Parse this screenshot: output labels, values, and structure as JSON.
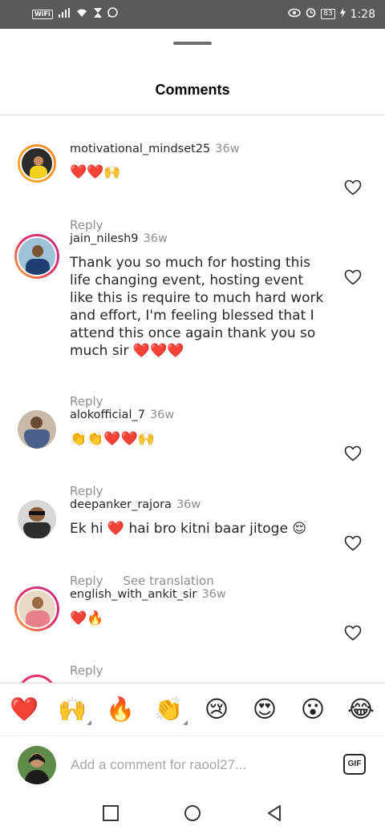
{
  "status_bar": {
    "left_icons": [
      "wifi-tag-icon",
      "signal-icon",
      "wifi-icon",
      "hourglass-icon",
      "whatsapp-icon"
    ],
    "wifi_tag": "WiFi",
    "battery": "83",
    "time": "1:28"
  },
  "sheet": {
    "title": "Comments"
  },
  "comments": [
    {
      "username": "motivational_mindset25",
      "time": "36w",
      "text": "❤️❤️🙌",
      "actions": [
        "Reply"
      ],
      "has_story_ring": false
    },
    {
      "username": "jain_nilesh9",
      "time": "36w",
      "text": "Thank you so much for hosting this life changing event, hosting event like this is require to much hard work and effort, I'm feeling blessed that I attend this once again thank you so much sir ❤️❤️❤️",
      "actions": [
        "Reply"
      ],
      "has_story_ring": true
    },
    {
      "username": "alokofficial_7",
      "time": "36w",
      "text": "👏👏❤️❤️🙌",
      "actions": [
        "Reply"
      ],
      "has_story_ring": false
    },
    {
      "username": "deepanker_rajora",
      "time": "36w",
      "text": "Ek hi ❤️ hai bro kitni baar jitoge 😌",
      "actions": [
        "Reply",
        "See translation"
      ],
      "has_story_ring": false
    },
    {
      "username": "english_with_ankit_sir",
      "time": "36w",
      "text": "❤️🔥",
      "actions": [
        "Reply"
      ],
      "has_story_ring": true
    }
  ],
  "emoji_bar": [
    "❤️",
    "🙌",
    "🔥",
    "👏",
    "😢",
    "😍",
    "😮",
    "😂"
  ],
  "input": {
    "placeholder": "Add a comment for raool27...",
    "gif_label": "GIF"
  },
  "colors": {
    "username": "#262626",
    "secondary_text": "#8e8e8e",
    "divider": "#dbdbdb",
    "heart_red": "#ed4956",
    "status_bar": "#5a5a5a"
  }
}
